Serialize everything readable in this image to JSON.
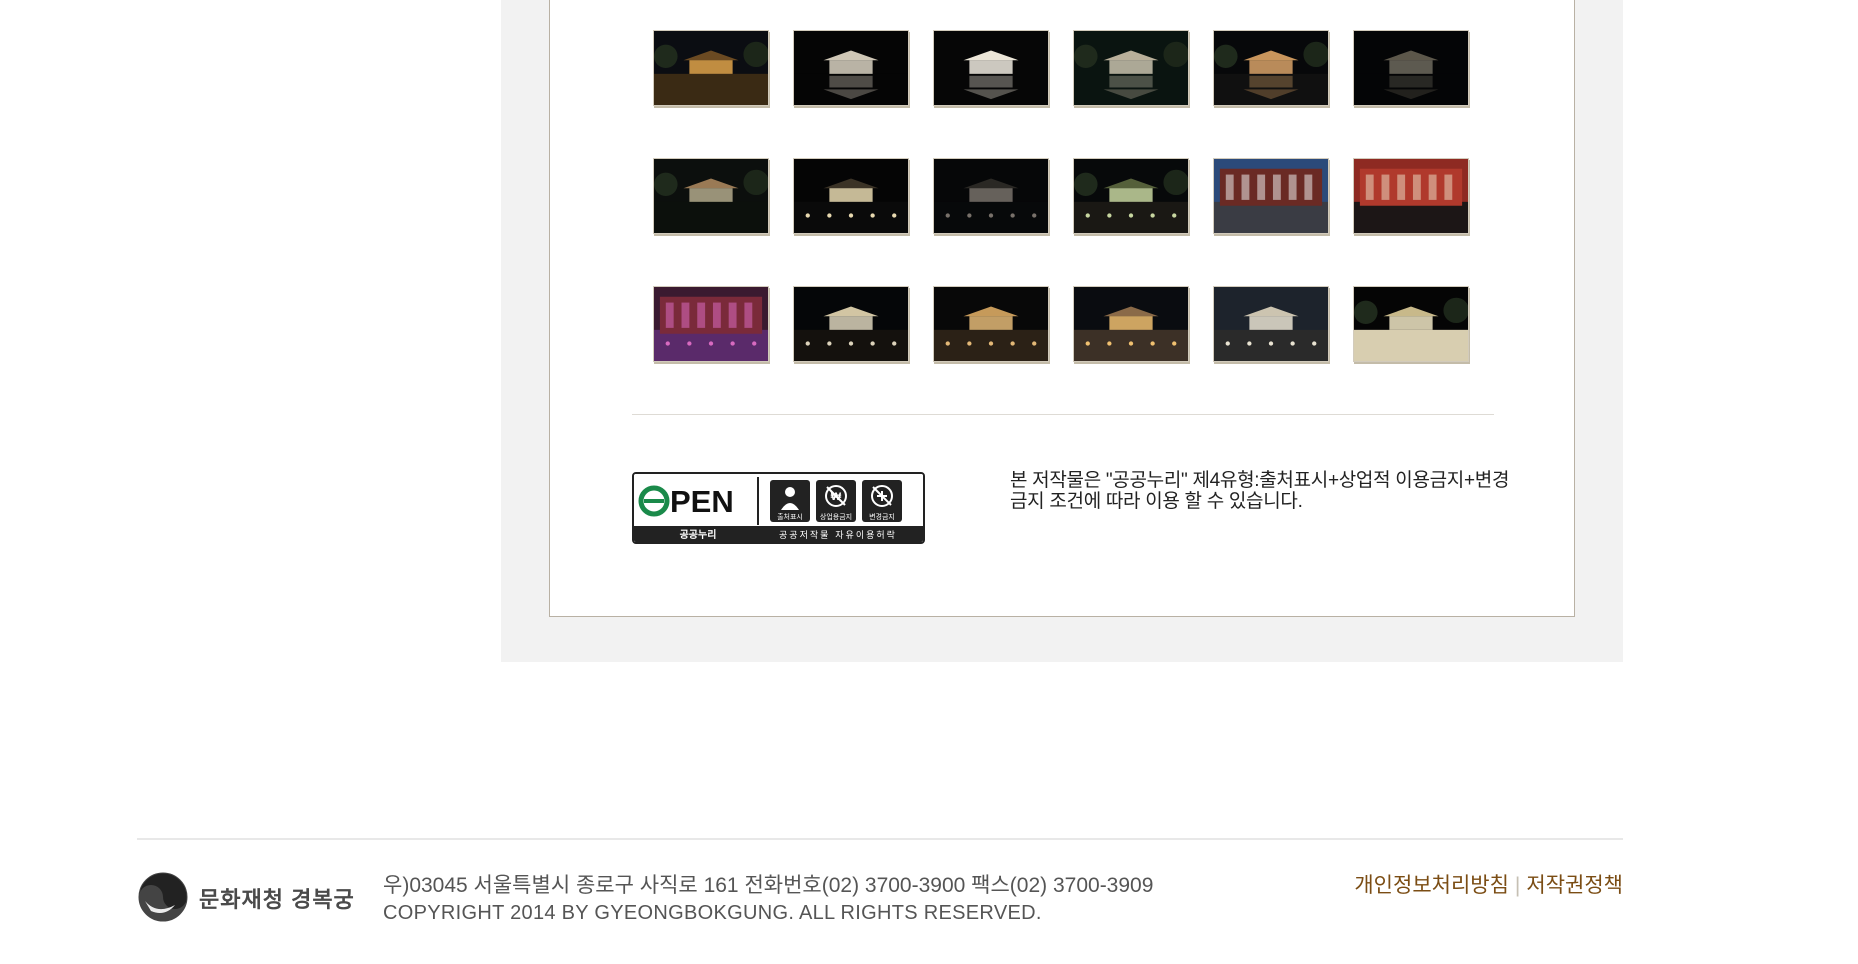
{
  "gallery": {
    "thumbnails": [
      {
        "alt": "gyeongbokgung-night-1",
        "scene": "courtyard"
      },
      {
        "alt": "gyeongbokgung-night-2",
        "scene": "pavilion-reflect"
      },
      {
        "alt": "gyeongbokgung-night-3",
        "scene": "pavilion-reflect-bright"
      },
      {
        "alt": "gyeongbokgung-night-4",
        "scene": "pavilion-small"
      },
      {
        "alt": "gyeongbokgung-night-5",
        "scene": "pavilion-trees"
      },
      {
        "alt": "gyeongbokgung-night-6",
        "scene": "pavilion-dark"
      },
      {
        "alt": "gyeongbokgung-night-7",
        "scene": "trees-pavilion"
      },
      {
        "alt": "gyeongbokgung-night-8",
        "scene": "pond-lights"
      },
      {
        "alt": "gyeongbokgung-night-9",
        "scene": "pond-dark"
      },
      {
        "alt": "gyeongbokgung-night-10",
        "scene": "lit-trees"
      },
      {
        "alt": "gyeongbokgung-night-11",
        "scene": "performer-hall"
      },
      {
        "alt": "gyeongbokgung-night-12",
        "scene": "hall-audience"
      },
      {
        "alt": "gyeongbokgung-night-13",
        "scene": "stage-performance"
      },
      {
        "alt": "gyeongbokgung-night-14",
        "scene": "gate-night"
      },
      {
        "alt": "gyeongbokgung-night-15",
        "scene": "gate-courtyard"
      },
      {
        "alt": "gyeongbokgung-night-16",
        "scene": "wide-courtyard"
      },
      {
        "alt": "gyeongbokgung-night-17",
        "scene": "city-gate"
      },
      {
        "alt": "gyeongbokgung-night-18",
        "scene": "gate-tower"
      }
    ]
  },
  "license": {
    "badge": {
      "open_label": "OPEN",
      "brand": "공공누리",
      "icons": [
        {
          "label": "출처표시",
          "icon": "person-icon"
        },
        {
          "label": "상업용금지",
          "icon": "no-commercial-icon"
        },
        {
          "label": "변경금지",
          "icon": "no-derivatives-icon"
        }
      ],
      "caption": "공공저작물 자유이용허락"
    },
    "text": "본 저작물은 \"공공누리\" 제4유형:출처표시+상업적 이용금지+변경금지 조건에 따라 이용 할 수 있습니다."
  },
  "footer": {
    "logo_text": "문화재청 경복궁",
    "address": "우)03045 서울특별시 종로구 사직로 161 전화번호(02) 3700-3900 팩스(02) 3700-3909",
    "copyright": "COPYRIGHT 2014 BY GYEONGBOKGUNG. ALL RIGHTS RESERVED.",
    "links": {
      "privacy": "개인정보처리방침",
      "separator": "|",
      "copyright_policy": "저작권정책"
    }
  },
  "colors": {
    "panel_bg": "#f2f2f2",
    "panel_border": "#b9b1a4",
    "footer_link": "#7b4d14",
    "text": "#222222"
  }
}
